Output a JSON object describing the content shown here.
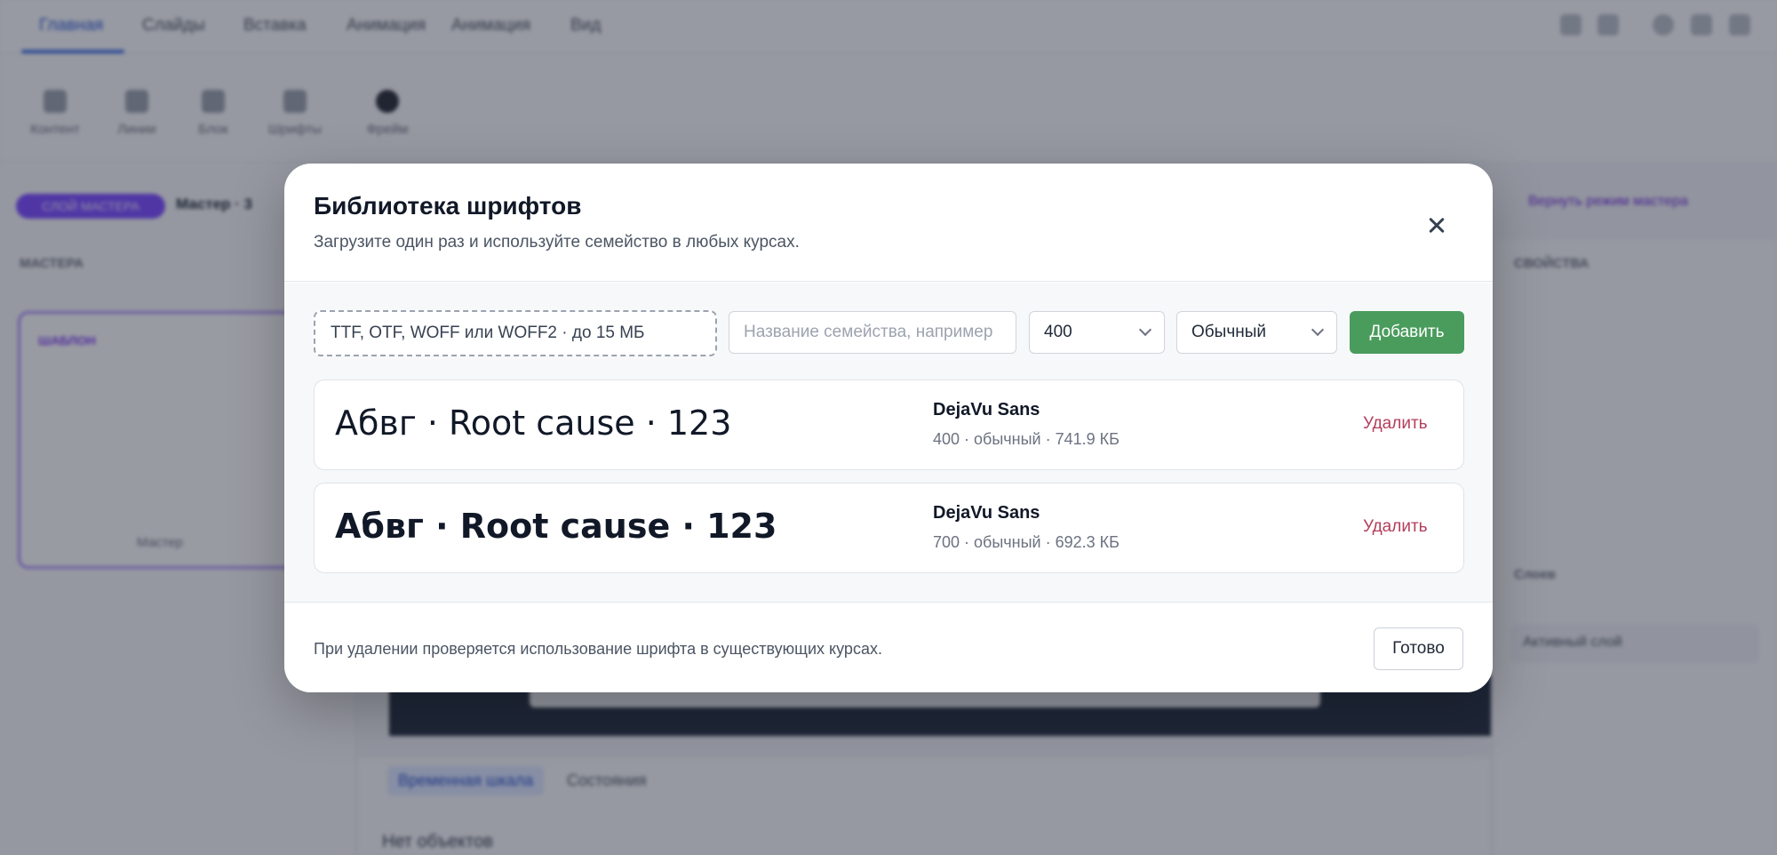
{
  "background": {
    "tabs": [
      "Главная",
      "Слайды",
      "Вставка",
      "Анимация",
      "Анимация",
      "Вид"
    ],
    "ribbon_items": [
      "Контент",
      "Линии",
      "Блок",
      "Шрифты",
      "Фрейм"
    ],
    "master_pill": "СЛОЙ МАСТЕРА",
    "master_label": "Мастер · 3",
    "left_section": "МАСТЕРА",
    "thumb_title": "ШАБЛОН",
    "thumb_footer": "Мастер",
    "right_section_top": "СВОЙСТВА",
    "right_section_mid": "Слоев",
    "right_row": "Активный слой",
    "right_link": "Вернуть режим мастера",
    "bottom_tabs": [
      "Временная шкала",
      "Состояния"
    ],
    "empty_text": "Нет объектов"
  },
  "modal": {
    "title": "Библиотека шрифтов",
    "subtitle": "Загрузите один раз и используйте семейство в любых курсах.",
    "file_drop_label": "TTF, OTF, WOFF или WOFF2 · до 15 МБ",
    "family_placeholder": "Название семейства, например",
    "weight_value": "400",
    "style_value": "Обычный",
    "add_label": "Добавить",
    "fonts": [
      {
        "preview": "Абвг · Root cause · 123",
        "name": "DejaVu Sans",
        "meta": "400 · обычный · 741.9 КБ",
        "delete_label": "Удалить"
      },
      {
        "preview": "Абвг · Root cause · 123",
        "name": "DejaVu Sans",
        "meta": "700 · обычный · 692.3 КБ",
        "delete_label": "Удалить"
      }
    ],
    "footer_note": "При удалении проверяется использование шрифта в существующих курсах.",
    "done_label": "Готово"
  }
}
